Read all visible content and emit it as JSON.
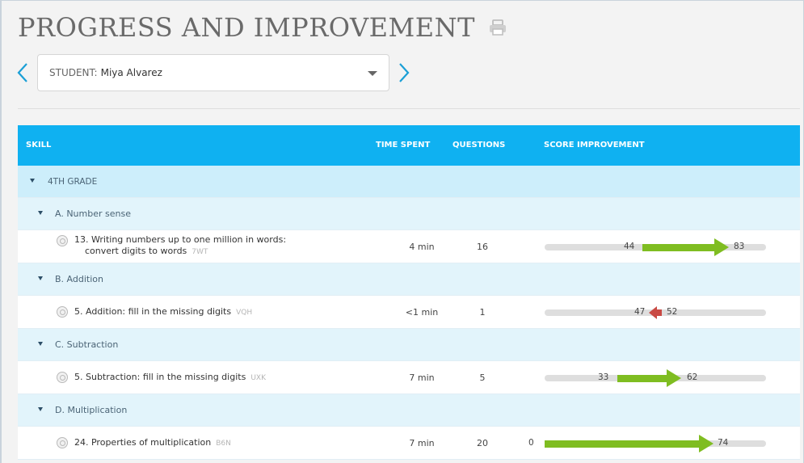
{
  "page": {
    "title": "PROGRESS AND IMPROVEMENT"
  },
  "student": {
    "label": "STUDENT:",
    "name": "Miya Alvarez"
  },
  "table": {
    "headers": {
      "skill": "SKILL",
      "time": "TIME SPENT",
      "questions": "QUESTIONS",
      "improvement": "SCORE IMPROVEMENT"
    },
    "grade": "4TH GRADE",
    "categories": [
      {
        "label": "A. Number sense",
        "skill": {
          "name_line1": "13. Writing numbers up to one million in words:",
          "name_line2": "convert digits to words",
          "code": "7WT",
          "time": "4 min",
          "questions": "16",
          "start": 44,
          "end": 83,
          "direction": "up"
        }
      },
      {
        "label": "B. Addition",
        "skill": {
          "name": "5. Addition: fill in the missing digits",
          "code": "VQH",
          "time": "<1 min",
          "questions": "1",
          "start": 52,
          "end": 47,
          "direction": "down"
        }
      },
      {
        "label": "C. Subtraction",
        "skill": {
          "name": "5. Subtraction: fill in the missing digits",
          "code": "UXK",
          "time": "7 min",
          "questions": "5",
          "start": 33,
          "end": 62,
          "direction": "up"
        }
      },
      {
        "label": "D. Multiplication",
        "skill": {
          "name": "24. Properties of multiplication",
          "code": "B6N",
          "time": "7 min",
          "questions": "20",
          "start": 0,
          "end": 74,
          "direction": "up"
        }
      }
    ]
  },
  "colors": {
    "header_blue": "#0fb1f1",
    "improve_green": "#7fbd21",
    "decline_red": "#c94a44",
    "chevron_blue": "#1a9fd6"
  },
  "icons": {
    "print": "print-icon",
    "prev": "chevron-left-icon",
    "next": "chevron-right-icon",
    "dropdown": "caret-down-icon",
    "skill": "skill-icon"
  }
}
